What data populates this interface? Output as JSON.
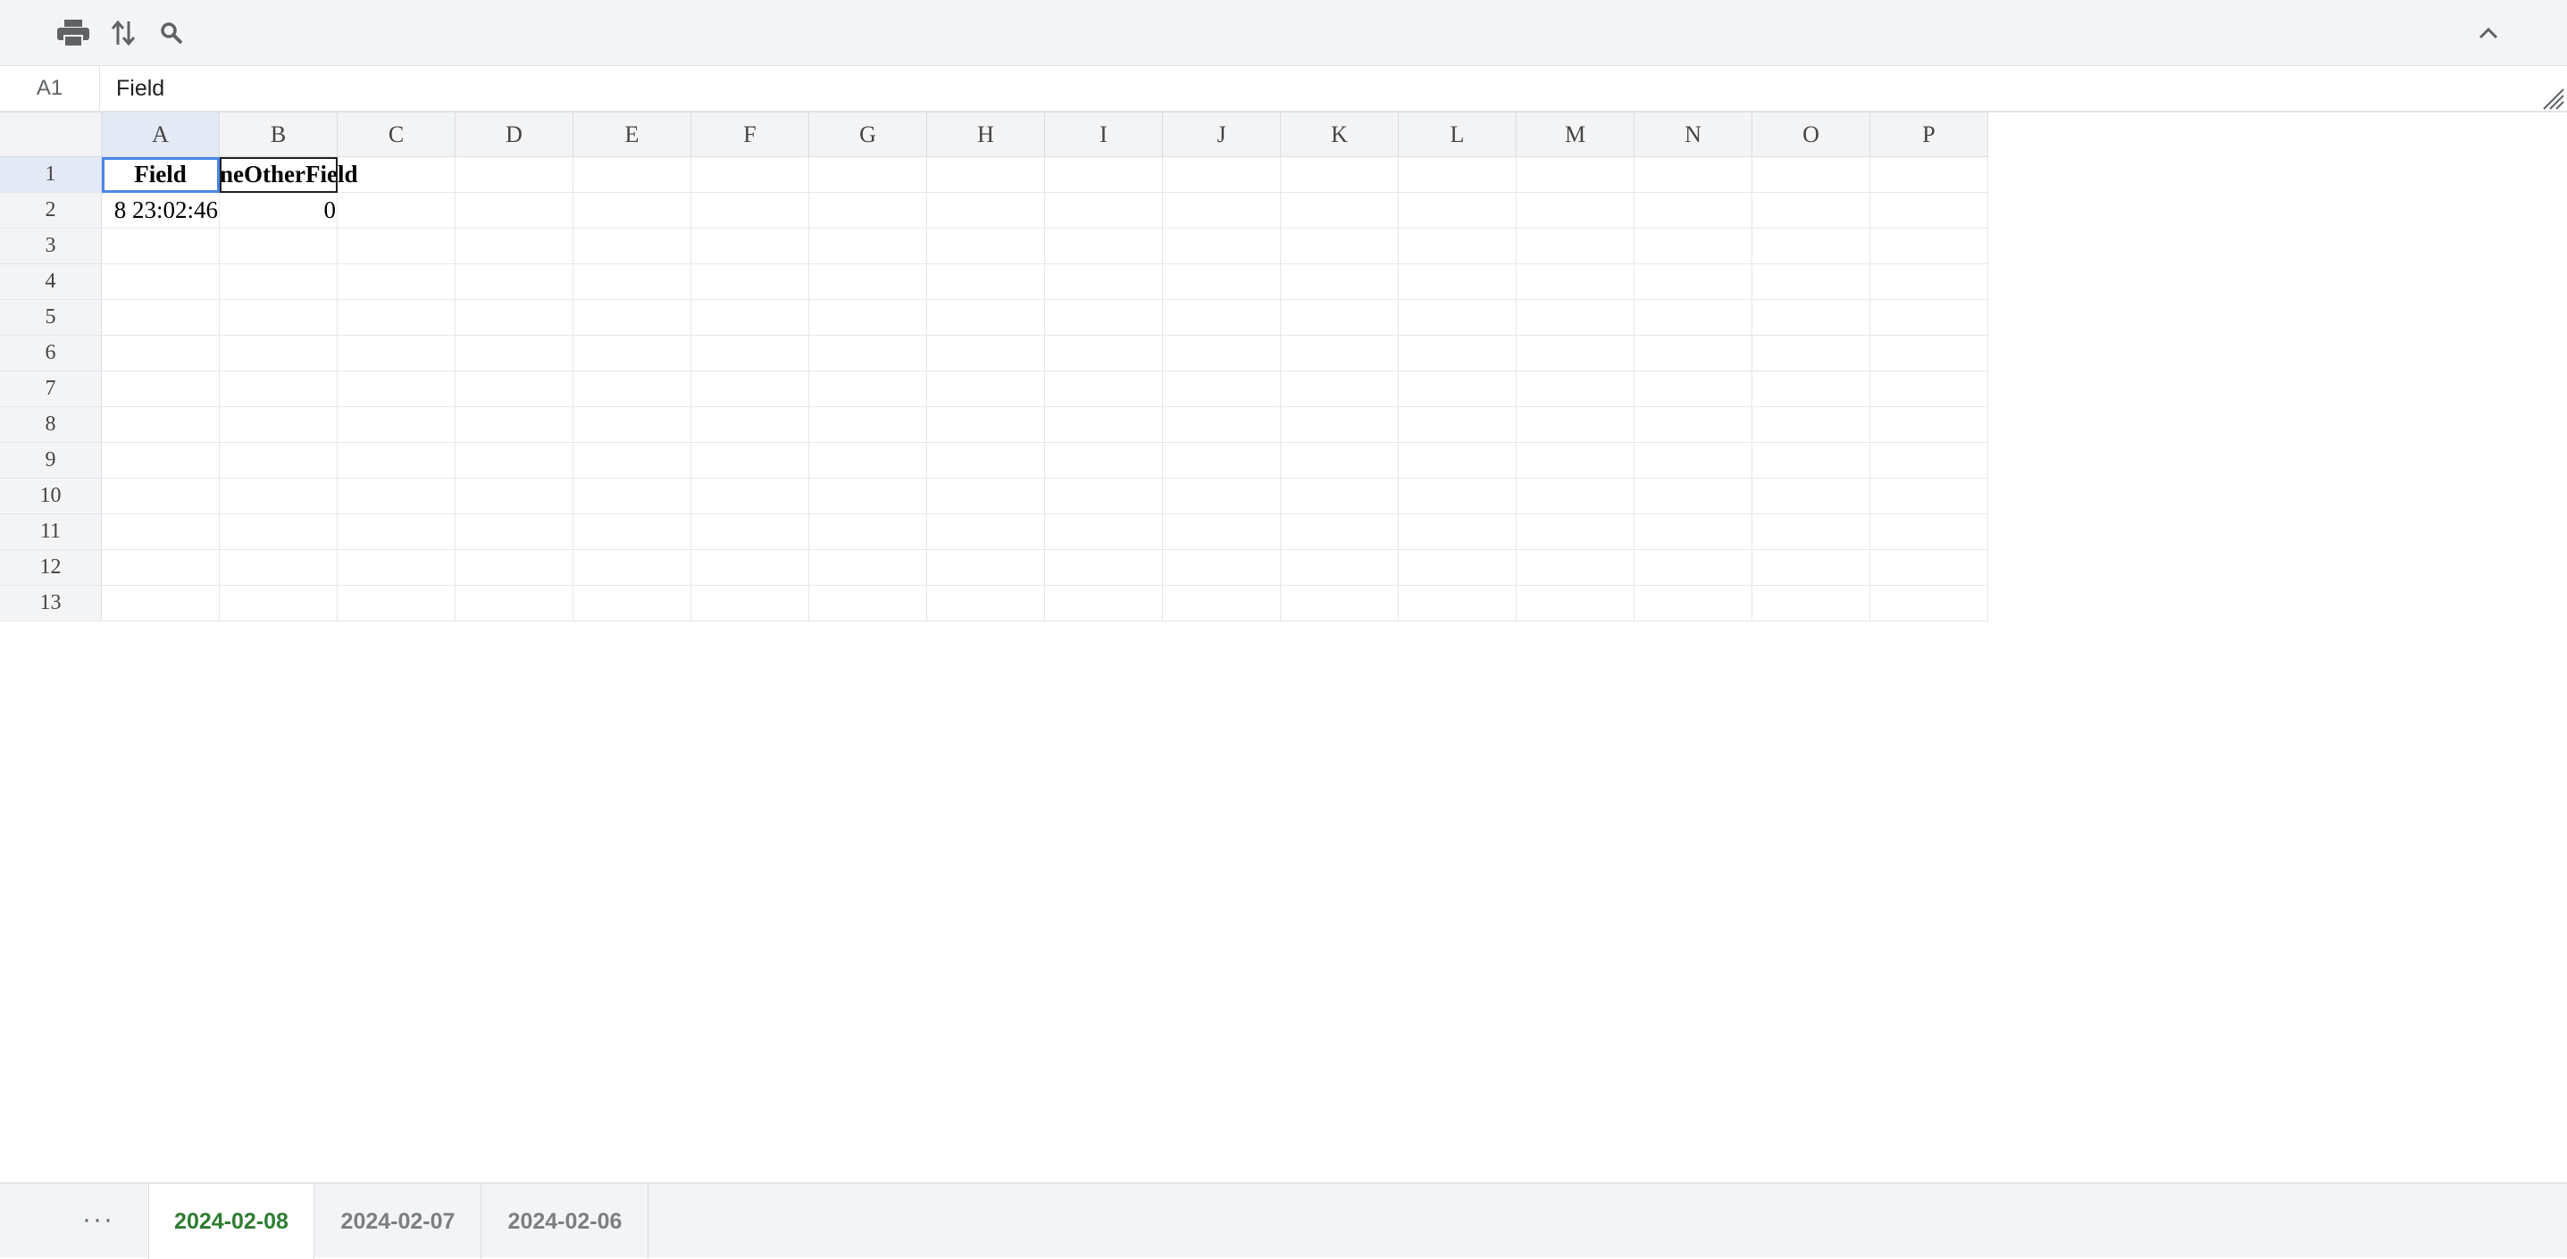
{
  "toolbar": {
    "icons": [
      "print-icon",
      "sort-icon",
      "search-icon",
      "chevron-up-icon"
    ]
  },
  "formula_bar": {
    "name_box": "A1",
    "value": "Field"
  },
  "grid": {
    "columns": [
      "A",
      "B",
      "C",
      "D",
      "E",
      "F",
      "G",
      "H",
      "I",
      "J",
      "K",
      "L",
      "M",
      "N",
      "O",
      "P"
    ],
    "rows": [
      "1",
      "2",
      "3",
      "4",
      "5",
      "6",
      "7",
      "8",
      "9",
      "10",
      "11",
      "12",
      "13"
    ],
    "active_cell": "A1",
    "cells": {
      "A1": "Field",
      "B1": "neOtherField",
      "A2": "8 23:02:46",
      "B2": "0"
    }
  },
  "sheets": {
    "more_label": "···",
    "tabs": [
      "2024-02-08",
      "2024-02-07",
      "2024-02-06"
    ],
    "active": "2024-02-08"
  },
  "colors": {
    "active_tab": "#2e7d32",
    "selection": "#4a86e8"
  }
}
